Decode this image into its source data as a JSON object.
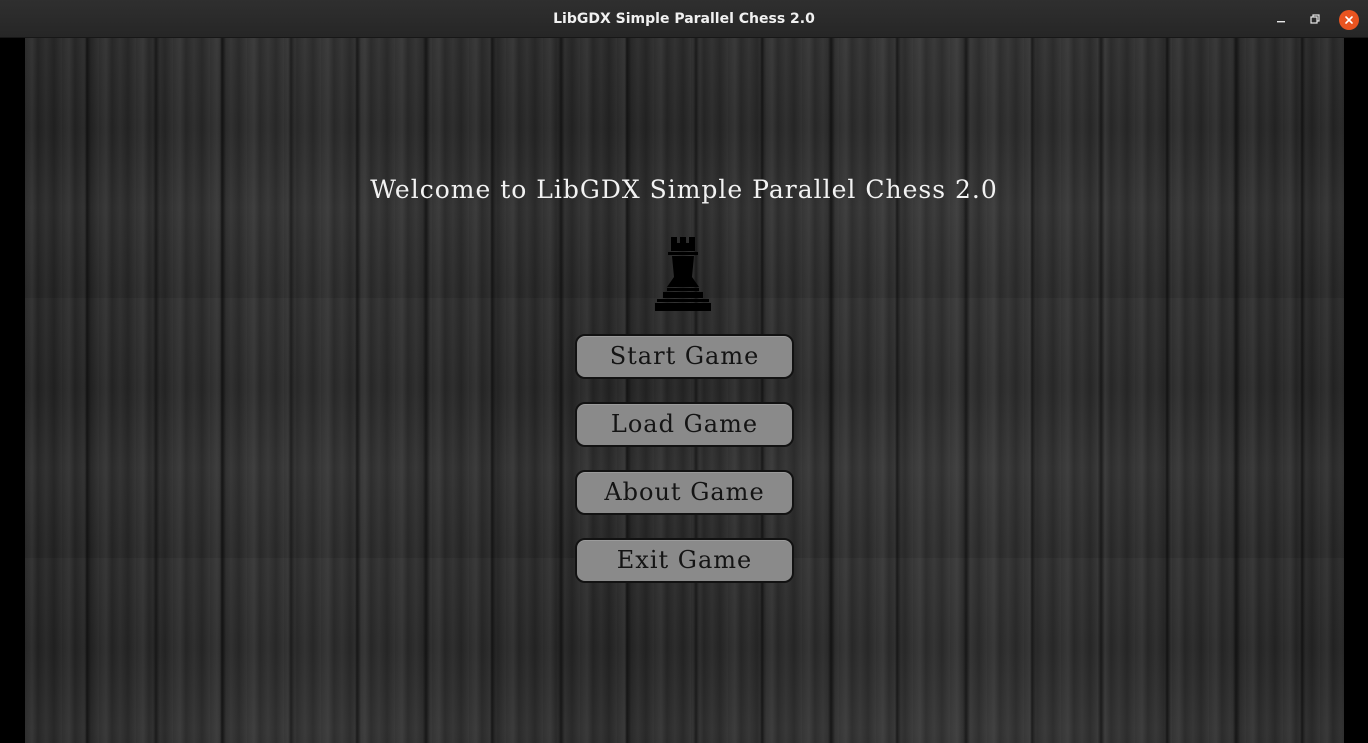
{
  "window": {
    "title": "LibGDX Simple Parallel Chess 2.0",
    "controls": {
      "minimize_icon": "minimize-icon",
      "maximize_icon": "maximize-icon",
      "close_icon": "close-icon",
      "close_color": "#e95420"
    }
  },
  "main_menu": {
    "welcome": "Welcome to LibGDX Simple Parallel Chess 2.0",
    "logo_icon": "rook-icon",
    "buttons": [
      {
        "label": "Start Game"
      },
      {
        "label": "Load Game"
      },
      {
        "label": "About Game"
      },
      {
        "label": "Exit Game"
      }
    ],
    "button_color": "#8a8a8a",
    "text_color": "#f2f2f2"
  }
}
